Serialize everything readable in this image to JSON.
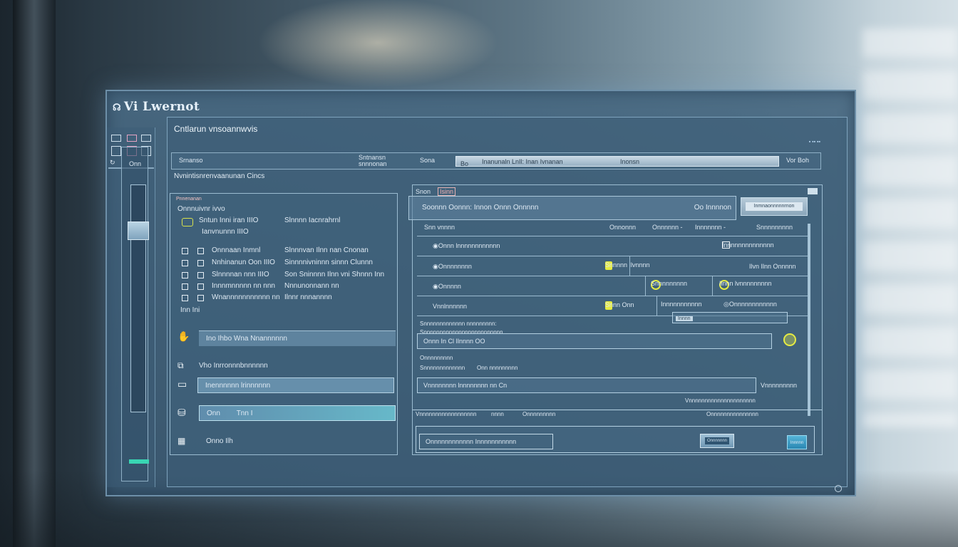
{
  "app": {
    "title": "Vi Lwernot",
    "section_title": "Cntlarun vnsoannwvis",
    "subtitle": "Nvnintisnrenvaanunan Cincs",
    "status_indicator": "▪ ▪▪ ▪▪"
  },
  "toolbar": {
    "item1": "Srnanso",
    "item2": "Sntnansn\nsnnnonan",
    "item3": "Sona",
    "search_prefix": "Bo",
    "search_placeholder": "Inanunaln LnIl: Inan Ivnanan",
    "search_suffix": "Inonsn",
    "right_label": "Vor Boh"
  },
  "left_rail": {
    "label": "Onn"
  },
  "left_panel": {
    "header": "Pnnenanan",
    "title": "Onnnuivnr ivvo",
    "rows": [
      {
        "c1": "Sntun Inni iran IIIO",
        "c2": "Slnnnn Iacnrahrnl"
      },
      {
        "c1": "Ianvnunnn IIIO",
        "c2": ""
      },
      {
        "c1": "Onnnaan Inmnl",
        "c2": "Slnnnvan Ilnn nan Cnonan"
      },
      {
        "c1": "Nnhinanun Oon IIIO",
        "c2": "Sinnnnivninnn sinnn Clunnn"
      },
      {
        "c1": "Slnnnnan nnn IIIO",
        "c2": "Son Sninnnn Ilnn vni Shnnn Inn"
      },
      {
        "c1": "Innnmnnnnn nn nnn",
        "c2": "Nnnunonnann nn"
      },
      {
        "c1": "Wnannnnnnnnnnn nn",
        "c2": "Ilnnr nnnannnn"
      },
      {
        "c1": "Inn Ini",
        "c2": ""
      }
    ],
    "bar1": "Ino Ihbo Wna Nnannnnnn",
    "mid_label": "Vho Inrronnnbnnnnnn",
    "bar2": "Inennnnnn lrinnnnnn",
    "bar3_a": "Onn",
    "bar3_b": "Tnn I",
    "bottom": "Onno Ilh"
  },
  "right_panel": {
    "tab": "Snon",
    "tab_badge": "Isinn",
    "header": "Soonnn Oonnn: Innon Onnn Onnnnn",
    "header_right": "Oo Innnnon",
    "header_button": "Inmnaonnnnnrnon",
    "col_headers": [
      "Snn vnnnn",
      "Onnonnn",
      "Onnnnnn -",
      "Innnnnnn -",
      "Snnnnnnnnn"
    ],
    "rows": [
      {
        "a": "Onnn lnnnnnnnnnnnn",
        "b": "",
        "c": "Innnnnnnnnnnnnn"
      },
      {
        "a": "Onnnnnnnn",
        "b": "Snnnnn Ilvnnnn",
        "c": "Ilvn Ilnn Onnnnn"
      },
      {
        "a": "Onnnnn",
        "b": "Snnnnnnnnn",
        "c": "Ilnnn lvnnnnnnnnn"
      },
      {
        "a": "Vnnlnnnnnn",
        "b": "Snnn Onn",
        "c": "Innnnnnnnnnn",
        "d": "Onnnnnnnnnnnn"
      }
    ],
    "field_small": "Innnn",
    "desc1": "Snnnnnnnnnnnnn nnnnnnnnn:",
    "desc2": "Snnnnnnnnnnnnnnnnnnnnnnnnn",
    "field1": "Onnn In Cl Ilnnnn OO",
    "desc3": "Onnnnnnnnn",
    "desc4": "Snnnnnnnnnnnnn",
    "desc5": "Onn nnnnnnnnn",
    "field2": "Vnnnnnnnn lnnnnnnnn nn Cn",
    "field2_right": "Vnnnnnnnnn",
    "strip_left": "Vnnnnnnnnnnnnnnnnnn",
    "strip_mid": "nnnn",
    "strip_mid2": "Onnnnnnnnn",
    "strip_right": "Onnnnnnnnnnnnnnn",
    "strip_far": "Vnnnnnnnnnnnnnnnnnnnnn",
    "footer_field": "Onnnnnnnnnnnn Innnnnnnnnnn",
    "footer_btn1": "Onnnnnnn",
    "footer_btn2": "Innnnn"
  },
  "colors": {
    "accent_yellow": "#e5eb43",
    "accent_teal": "#39d6b3",
    "accent_blue": "#2a87b2"
  }
}
